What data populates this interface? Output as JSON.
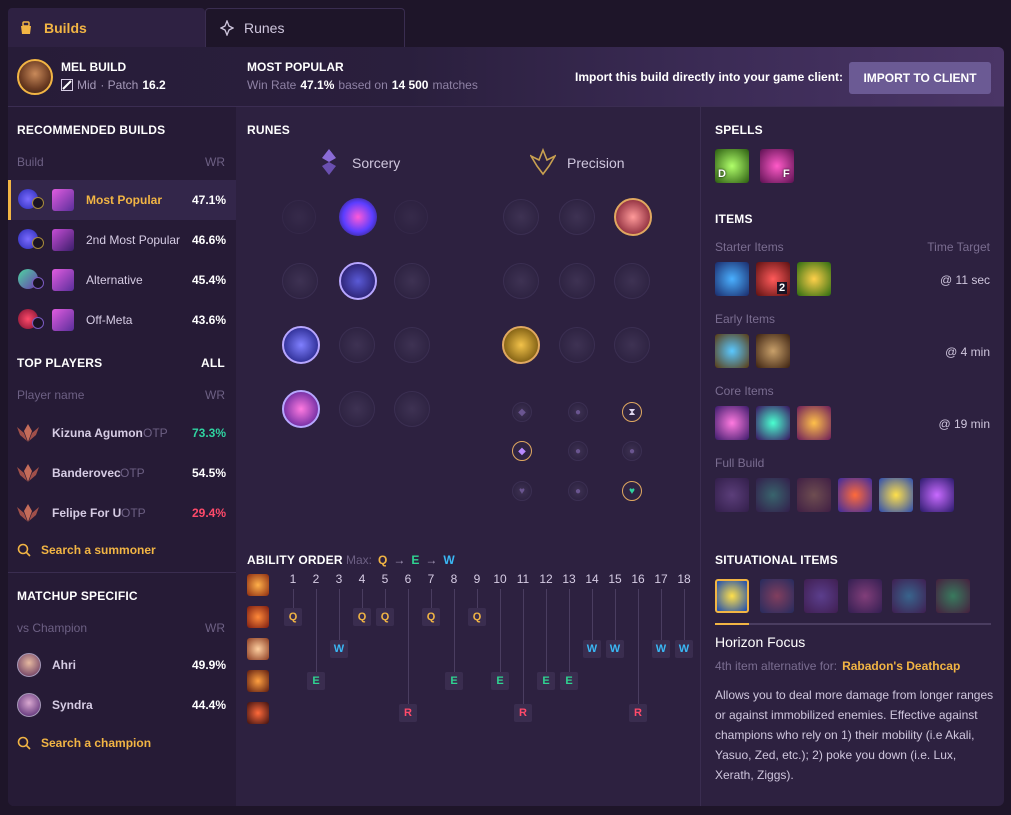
{
  "tabs": {
    "builds": "Builds",
    "runes": "Runes"
  },
  "header": {
    "champion": "MEL BUILD",
    "role": "Mid",
    "patch_label": "· Patch",
    "patch": "16.2",
    "most_popular": "MOST POPULAR",
    "winrate_label": "Win Rate",
    "winrate": "47.1%",
    "based_on": "based on",
    "matches": "14 500",
    "matches_label": "matches",
    "import_text": "Import this build directly into your game client:",
    "import_button": "IMPORT TO CLIENT"
  },
  "recommended": {
    "title": "RECOMMENDED BUILDS",
    "col_build": "Build",
    "col_wr": "WR",
    "rows": [
      {
        "label": "Most Popular",
        "wr": "47.1%"
      },
      {
        "label": "2nd Most Popular",
        "wr": "46.6%"
      },
      {
        "label": "Alternative",
        "wr": "45.4%"
      },
      {
        "label": "Off-Meta",
        "wr": "43.6%"
      }
    ]
  },
  "top_players": {
    "title": "TOP PLAYERS",
    "all": "ALL",
    "col_player": "Player name",
    "col_wr": "WR",
    "rows": [
      {
        "name": "Kizuna Agumon",
        "tag": "OTP",
        "wr": "73.3%",
        "color": "#2fd3a0"
      },
      {
        "name": "Banderovec",
        "tag": "OTP",
        "wr": "54.5%",
        "color": "#ffffff"
      },
      {
        "name": "Felipe For U",
        "tag": "OTP",
        "wr": "29.4%",
        "color": "#ff4a6a"
      }
    ],
    "search": "Search a summoner"
  },
  "matchup": {
    "title": "MATCHUP SPECIFIC",
    "col_vs": "vs Champion",
    "col_wr": "WR",
    "rows": [
      {
        "name": "Ahri",
        "wr": "49.9%"
      },
      {
        "name": "Syndra",
        "wr": "44.4%"
      }
    ],
    "search": "Search a champion"
  },
  "runes": {
    "title": "RUNES",
    "primary": "Sorcery",
    "secondary": "Precision"
  },
  "ability": {
    "title": "ABILITY ORDER",
    "max": "Max:",
    "seq": [
      "Q",
      "E",
      "W"
    ],
    "arrow": "→",
    "levels": [
      "1",
      "2",
      "3",
      "4",
      "5",
      "6",
      "7",
      "8",
      "9",
      "10",
      "11",
      "12",
      "13",
      "14",
      "15",
      "16",
      "17",
      "18"
    ],
    "q": "Q",
    "w": "W",
    "e": "E",
    "r": "R"
  },
  "spells": {
    "title": "SPELLS",
    "keys": [
      "D",
      "F"
    ]
  },
  "items": {
    "title": "ITEMS",
    "starter": "Starter Items",
    "time_target": "Time Target",
    "starter_time": "@ 11 sec",
    "starter_count": "2",
    "early": "Early Items",
    "early_time": "@ 4 min",
    "core": "Core Items",
    "core_time": "@ 19 min",
    "full": "Full Build"
  },
  "situational": {
    "title": "SITUATIONAL ITEMS",
    "item_name": "Horizon Focus",
    "alt_label": "4th item alternative for:",
    "alt_item": "Rabadon's Deathcap",
    "description": "Allows you to deal more damage from longer ranges or against immobilized enemies. Effective against champions who rely on 1) their mobility (i.e Akali, Yasuo, Zed, etc.); 2) poke you down (i.e. Lux, Xerath, Ziggs)."
  }
}
